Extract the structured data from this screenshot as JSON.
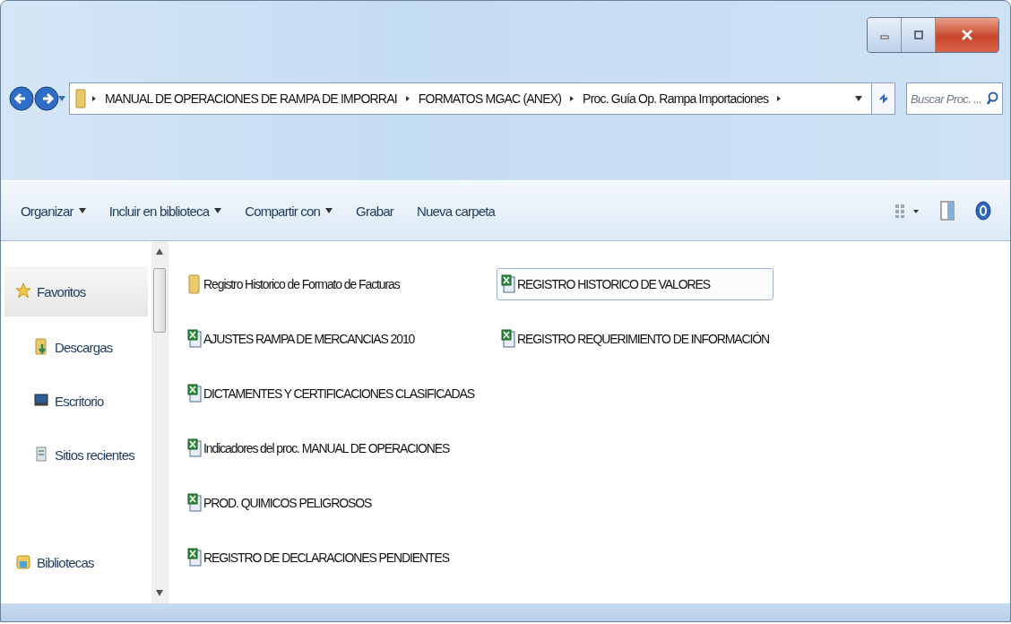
{
  "address_bar": {
    "breadcrumbs": [
      "MANUAL DE OPERACIONES DE RAMPA DE IMPORRAI",
      "FORMATOS MGAC (ANEX)",
      "Proc. Guía Op. Rampa Importaciones"
    ]
  },
  "search": {
    "placeholder": "Buscar Proc. ..."
  },
  "toolbar": [
    {
      "label": "Organizar",
      "dropdown": true
    },
    {
      "label": "Incluir en biblioteca",
      "dropdown": true
    },
    {
      "label": "Compartir con",
      "dropdown": true
    },
    {
      "label": "Grabar",
      "dropdown": false
    },
    {
      "label": "Nueva carpeta",
      "dropdown": false
    }
  ],
  "sidebar": {
    "items": [
      {
        "label": "Favoritos",
        "kind": "favorites",
        "selected": true
      },
      {
        "label": "Descargas",
        "kind": "downloads",
        "selected": false
      },
      {
        "label": "Escritorio",
        "kind": "desktop",
        "selected": false
      },
      {
        "label": "Sitios recientes",
        "kind": "recent",
        "selected": false
      },
      {
        "label": "Bibliotecas",
        "kind": "libraries",
        "selected": false
      }
    ]
  },
  "files": [
    {
      "name": "Registro Historico de Formato de Facturas",
      "kind": "folder",
      "selected": false
    },
    {
      "name": "AJUSTES RAMPA DE MERCANCIAS 2010",
      "kind": "excel",
      "selected": false
    },
    {
      "name": "DICTAMENTES Y CERTIFICACIONES CLASIFICADAS",
      "kind": "excel",
      "selected": false
    },
    {
      "name": "Indicadores del proc. MANUAL DE OPERACIONES",
      "kind": "excel",
      "selected": false
    },
    {
      "name": "PROD. QUIMICOS PELIGROSOS",
      "kind": "excel",
      "selected": false
    },
    {
      "name": "REGISTRO DE DECLARACIONES PENDIENTES",
      "kind": "excel",
      "selected": false
    },
    {
      "name": "REGISTRO HISTORICO DE VALORES",
      "kind": "excel",
      "selected": true
    },
    {
      "name": "REGISTRO REQUERIMIENTO DE INFORMACIÓN",
      "kind": "excel",
      "selected": false
    }
  ]
}
